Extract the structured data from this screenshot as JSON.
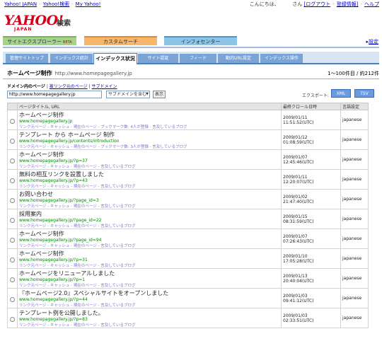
{
  "topbar": {
    "left_links": [
      "Yahoo! JAPAN",
      "Yahoo!検索",
      "My Yahoo!"
    ],
    "greeting": "こんにちは、",
    "san": "さん",
    "logout": "[ログアウト",
    "reg_info": "登録情報]",
    "help": "ヘルプ"
  },
  "logo": {
    "yahoo": "YAHOO!",
    "japan": "JAPAN",
    "kensaku": "検索"
  },
  "service_tabs": [
    {
      "label": "サイトエクスプローラー",
      "badge": "BETA"
    },
    {
      "label": "カスタムサーチ"
    },
    {
      "label": "インフォセンター"
    }
  ],
  "settings_link": "設定",
  "sub_tabs": [
    "管理サイトトップ",
    "インデックス統計",
    "インデックス状況",
    "サイト認証",
    "フィード",
    "動的URL設定",
    "インデックス操作"
  ],
  "active_sub_tab": 2,
  "site": {
    "title": "ホームページ制作",
    "url": "http://www.homepagegallery.jp",
    "count": "1〜100件目 / 約212件"
  },
  "filter": {
    "label": "ドメイン内のページ",
    "link1": "被リンク元のページ",
    "link2": "サブドメイン",
    "sep": "|"
  },
  "controls": {
    "url_value": "http://www.homepagegallery.jp",
    "select_value": "サブドメインを含む",
    "show_button": "表示"
  },
  "export": {
    "label": "エクスポート:",
    "xml": "XML",
    "tsv": "TSV"
  },
  "table": {
    "headers": [
      "ページタイトル, URL",
      "最終クロール日時",
      "言語設定"
    ],
    "rows": [
      {
        "title": "ホームページ制作",
        "url": "www.homepagegallery.jp",
        "sub": "リンク元ページ - キャッシュ - 現在のページ - ブックマーク数: 4人が登録 - 言及しているブログ",
        "date": "2009/01/11 11:51:52(UTC)",
        "lang": "japanese"
      },
      {
        "title": "テンプレート から ホームページ 制作",
        "url": "www.homepagegallery.jp/contents/introduction",
        "sub": "リンク元ページ - キャッシュ - 現在のページ - ブックマーク数: 3人が登録 - 言及しているブログ",
        "date": "2009/01/12 01:08:59(UTC)",
        "lang": "japanese"
      },
      {
        "title": "ホームページ制作",
        "url": "www.homepagegallery.jp/?p=37",
        "sub": "リンク元ページ - キャッシュ - 現在のページ - 言及しているブログ",
        "date": "2009/01/07 12:45:46(UTC)",
        "lang": "japanese"
      },
      {
        "title": "無料の相互リンクを設置しました",
        "url": "www.homepagegallery.jp/?p=43",
        "sub": "リンク元ページ - キャッシュ - 現在のページ - 言及しているブログ",
        "date": "2009/01/11 12:20:07(UTC)",
        "lang": "japanese"
      },
      {
        "title": "お問い合わせ",
        "url": "www.homepagegallery.jp/?page_id=3",
        "sub": "リンク元ページ - キャッシュ - 現在のページ - 言及しているブログ",
        "date": "2009/01/02 21:47:40(UTC)",
        "lang": "japanese"
      },
      {
        "title": "採用案内",
        "url": "www.homepagegallery.jp/?page_id=22",
        "sub": "リンク元ページ - キャッシュ - 現在のページ - 言及しているブログ",
        "date": "2009/01/15 08:31:59(UTC)",
        "lang": "japanese"
      },
      {
        "title": "ホームページ制作",
        "url": "www.homepagegallery.jp/?page_id=94",
        "sub": "リンク元ページ - キャッシュ - 現在のページ - 言及しているブログ",
        "date": "2009/01/07 07:26:43(UTC)",
        "lang": "japanese"
      },
      {
        "title": "ホームページ制作",
        "url": "www.homepagegallery.jp/?p=31",
        "sub": "リンク元ページ - キャッシュ - 現在のページ - 言及しているブログ",
        "date": "2009/01/10 17:05:28(UTC)",
        "lang": "japanese"
      },
      {
        "title": "ホームページをリニューアルしました",
        "url": "www.homepagegallery.jp/?p=1",
        "sub": "リンク元ページ - キャッシュ - 現在のページ - 言及しているブログ",
        "date": "2009/01/13 20:40:04(UTC)",
        "lang": "japanese"
      },
      {
        "title": "『ホームページ2.0』スペシャルサイトをオープンしました",
        "url": "www.homepagegallery.jp/?p=44",
        "sub": "リンク元ページ - キャッシュ - 現在のページ - 言及しているブログ",
        "date": "2009/01/03 09:41:12(UTC)",
        "lang": "japanese"
      },
      {
        "title": "テンプレート例を公開しました。",
        "url": "www.homepagegallery.jp/?p=83",
        "sub": "リンク元ページ - キャッシュ - 現在のページ - 言及しているブログ",
        "date": "2009/01/03 02:33:51(UTC)",
        "lang": "japanese"
      }
    ]
  }
}
